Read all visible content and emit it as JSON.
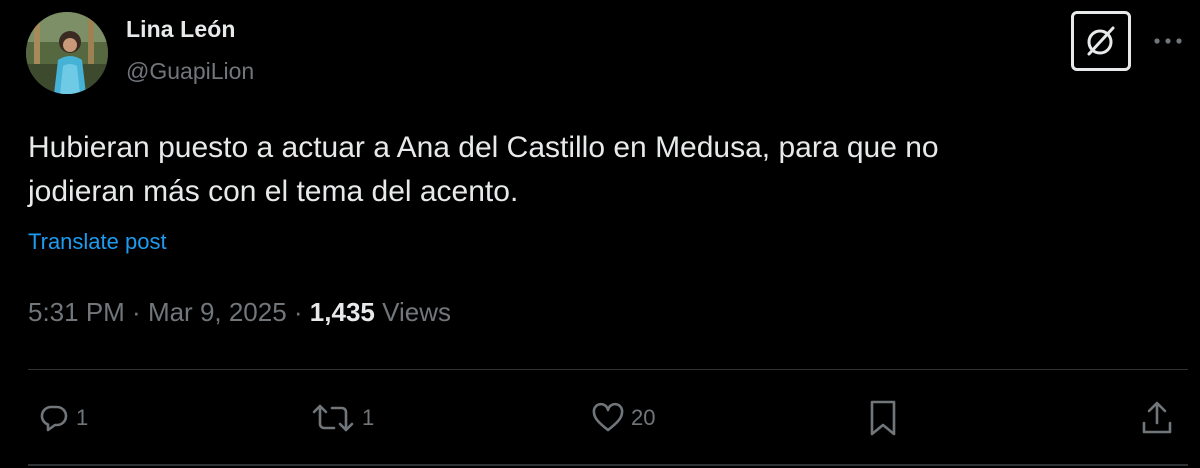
{
  "author": {
    "name": "Lina León",
    "handle": "@GuapiLion"
  },
  "post": {
    "line1": "Hubieran puesto a actuar a Ana del Castillo en Medusa, para que no",
    "line2": "jodieran más con el tema del acento.",
    "translate_label": "Translate post"
  },
  "meta": {
    "time": "5:31 PM",
    "separator1": " · ",
    "date": "Mar 9, 2025",
    "separator2": " · ",
    "views_count": "1,435",
    "views_label": " Views"
  },
  "actions": {
    "replies": "1",
    "reposts": "1",
    "likes": "20"
  },
  "icons": {
    "grok": "grok-icon",
    "more": "more-icon",
    "reply": "reply-icon",
    "repost": "repost-icon",
    "like": "heart-icon",
    "bookmark": "bookmark-icon",
    "share": "share-icon"
  },
  "colors": {
    "background": "#000000",
    "text": "#e7e9ea",
    "muted": "#71767b",
    "link": "#1d9bf0",
    "divider": "#2f3336"
  }
}
